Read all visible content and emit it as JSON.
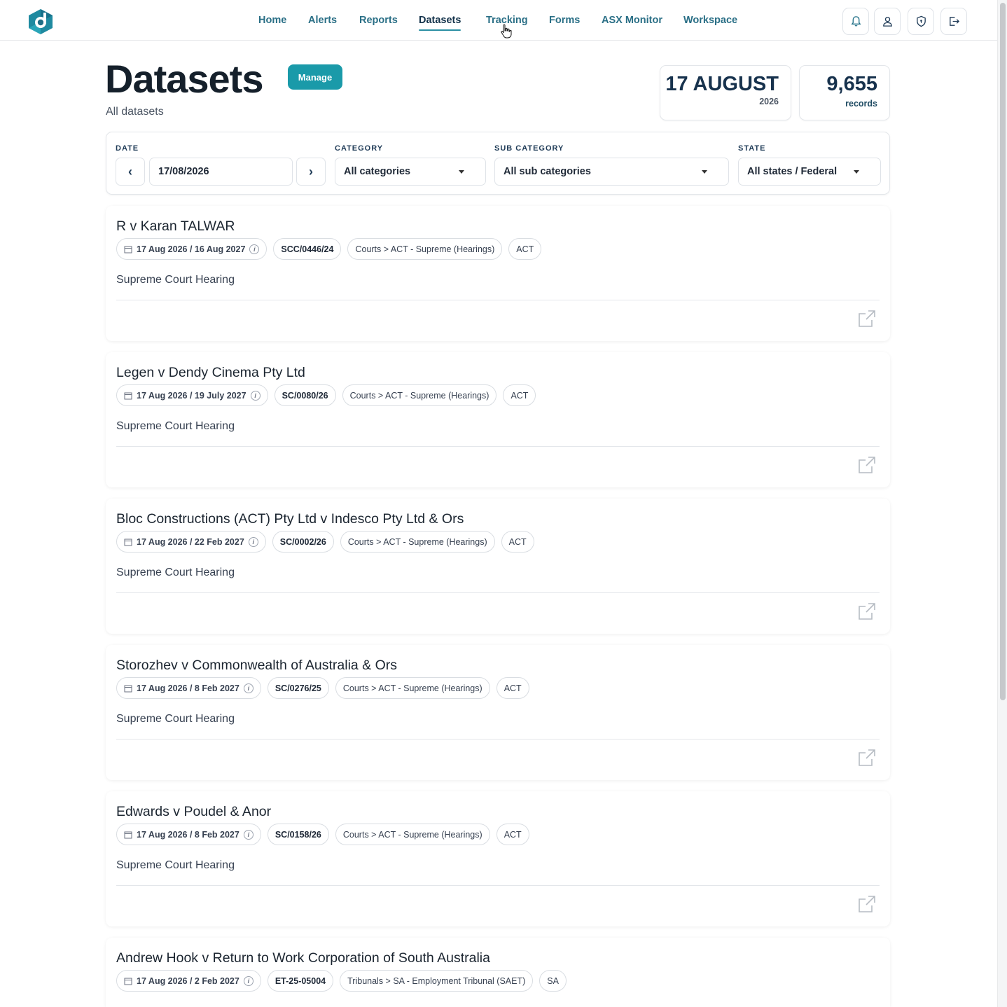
{
  "nav": {
    "items": [
      {
        "label": "Home",
        "active": false
      },
      {
        "label": "Alerts",
        "active": false
      },
      {
        "label": "Reports",
        "active": false
      },
      {
        "label": "Datasets",
        "active": true
      },
      {
        "label": "Tracking",
        "active": false
      },
      {
        "label": "Forms",
        "active": false
      },
      {
        "label": "ASX Monitor",
        "active": false
      },
      {
        "label": "Workspace",
        "active": false
      }
    ],
    "icons": [
      "bell-icon",
      "user-icon",
      "shield-icon",
      "logout-icon"
    ]
  },
  "header": {
    "title": "Datasets",
    "manage_label": "Manage",
    "subtitle": "All datasets"
  },
  "stats": {
    "date_big": "17 AUGUST",
    "date_year": "2026",
    "count_big": "9,655",
    "count_label": "records"
  },
  "filters": {
    "date_label": "DATE",
    "date_value": "17/08/2026",
    "category_label": "CATEGORY",
    "category_value": "All categories",
    "sub_category_label": "SUB CATEGORY",
    "sub_category_value": "All sub categories",
    "state_label": "STATE",
    "state_value": "All states / Federal"
  },
  "records": [
    {
      "title": "R v Karan TALWAR",
      "dates": "17 Aug 2026 / 16 Aug 2027",
      "ref": "SCC/0446/24",
      "path": "Courts > ACT - Supreme (Hearings)",
      "state": "ACT",
      "description": "Supreme Court Hearing"
    },
    {
      "title": "Legen v Dendy Cinema Pty Ltd",
      "dates": "17 Aug 2026 / 19 July 2027",
      "ref": "SC/0080/26",
      "path": "Courts > ACT - Supreme (Hearings)",
      "state": "ACT",
      "description": "Supreme Court Hearing"
    },
    {
      "title": "Bloc Constructions (ACT) Pty Ltd v Indesco Pty Ltd & Ors",
      "dates": "17 Aug 2026 / 22 Feb 2027",
      "ref": "SC/0002/26",
      "path": "Courts > ACT - Supreme (Hearings)",
      "state": "ACT",
      "description": "Supreme Court Hearing"
    },
    {
      "title": "Storozhev v Commonwealth of Australia & Ors",
      "dates": "17 Aug 2026 / 8 Feb 2027",
      "ref": "SC/0276/25",
      "path": "Courts > ACT - Supreme (Hearings)",
      "state": "ACT",
      "description": "Supreme Court Hearing"
    },
    {
      "title": "Edwards v Poudel & Anor",
      "dates": "17 Aug 2026 / 8 Feb 2027",
      "ref": "SC/0158/26",
      "path": "Courts > ACT - Supreme (Hearings)",
      "state": "ACT",
      "description": "Supreme Court Hearing"
    },
    {
      "title": "Andrew Hook v Return to Work Corporation of South Australia",
      "dates": "17 Aug 2026 / 2 Feb 2027",
      "ref": "ET-25-05004",
      "path": "Tribunals > SA - Employment Tribunal (SAET)",
      "state": "SA",
      "description": ""
    }
  ],
  "colors": {
    "accent": "#1a9aa9",
    "nav_text": "#2a6f86",
    "heading": "#15202b"
  }
}
